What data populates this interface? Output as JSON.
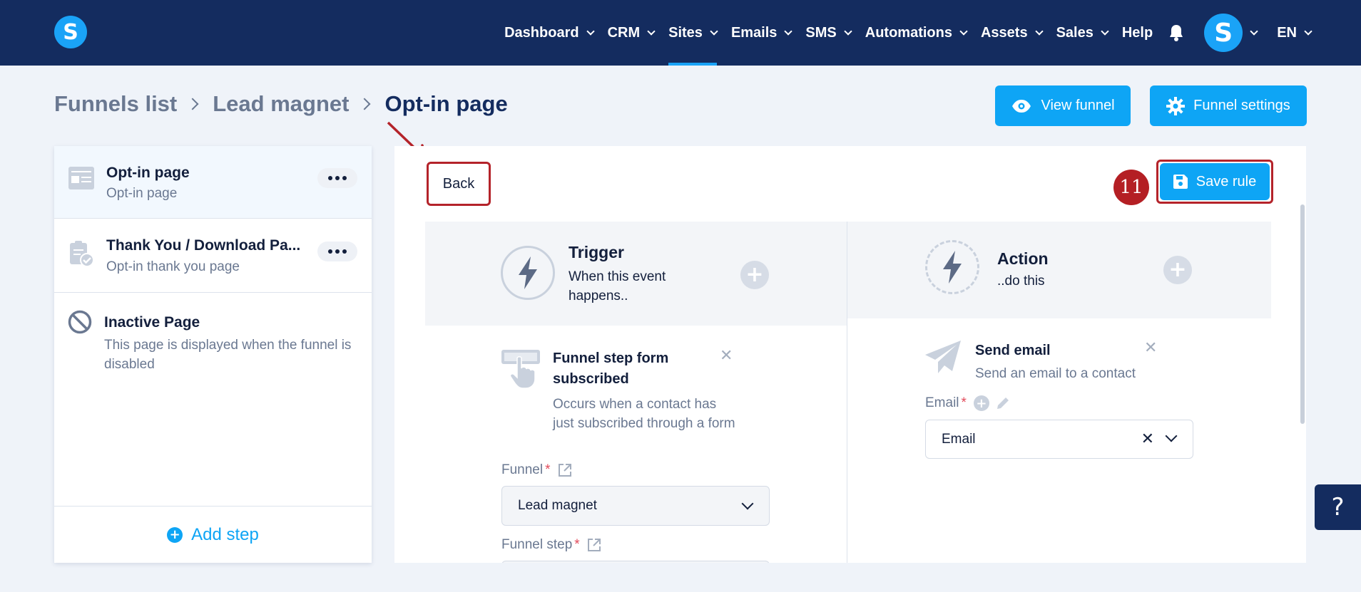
{
  "app": {
    "logo_letter": "S"
  },
  "nav": {
    "items": [
      {
        "label": "Dashboard",
        "dropdown": true,
        "active": false
      },
      {
        "label": "CRM",
        "dropdown": true,
        "active": false
      },
      {
        "label": "Sites",
        "dropdown": true,
        "active": true
      },
      {
        "label": "Emails",
        "dropdown": true,
        "active": false
      },
      {
        "label": "SMS",
        "dropdown": true,
        "active": false
      },
      {
        "label": "Automations",
        "dropdown": true,
        "active": false
      },
      {
        "label": "Assets",
        "dropdown": true,
        "active": false
      },
      {
        "label": "Sales",
        "dropdown": true,
        "active": false
      },
      {
        "label": "Help",
        "dropdown": false,
        "active": false
      }
    ],
    "avatar_letter": "S",
    "language": "EN"
  },
  "breadcrumb": {
    "items": [
      "Funnels list",
      "Lead magnet"
    ],
    "current": "Opt-in page"
  },
  "header_actions": {
    "view_funnel": "View funnel",
    "funnel_settings": "Funnel settings"
  },
  "sidebar": {
    "steps": [
      {
        "title": "Opt-in page",
        "subtitle": "Opt-in page",
        "icon": "page-layout-icon"
      },
      {
        "title": "Thank You / Download Pa...",
        "subtitle": "Opt-in thank you page",
        "icon": "clipboard-check-icon"
      },
      {
        "title": "Inactive Page",
        "subtitle": "This page is displayed when the funnel is disabled",
        "icon": "ban-icon"
      }
    ],
    "add_step": "Add step"
  },
  "rule": {
    "back": "Back",
    "step_badge": "11",
    "save": "Save rule",
    "trigger": {
      "title": "Trigger",
      "subtitle": "When this event happens..",
      "card_title": "Funnel step form subscribed",
      "card_desc": "Occurs when a contact has just subscribed through a form",
      "funnel_label": "Funnel",
      "funnel_value": "Lead magnet",
      "funnel_step_label": "Funnel step"
    },
    "action": {
      "title": "Action",
      "subtitle": "..do this",
      "card_title": "Send email",
      "card_desc": "Send an email to a contact",
      "email_label": "Email",
      "email_value": "Email"
    }
  },
  "help_fab": "?",
  "colors": {
    "nav_bg": "#142c5f",
    "accent": "#0ea5f5",
    "highlight": "#b4232a",
    "page_bg": "#eff3f9"
  }
}
